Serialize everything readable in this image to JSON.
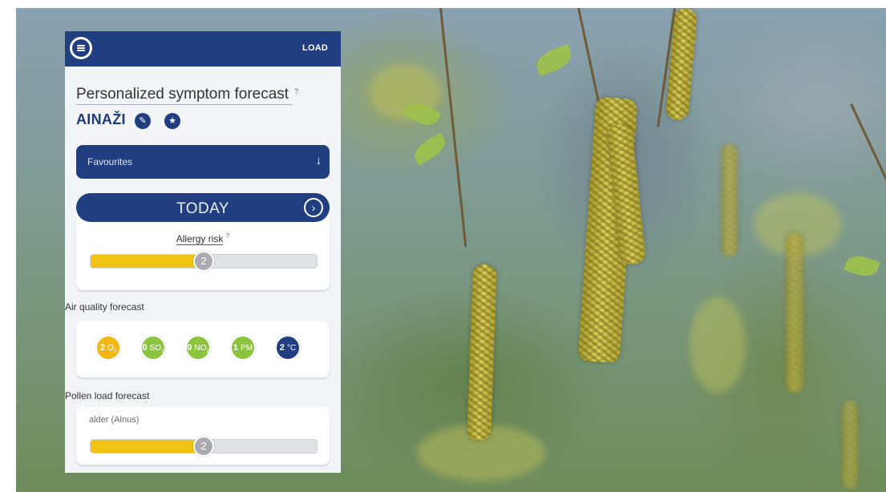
{
  "header": {
    "menu_icon": "hamburger-menu-icon",
    "load_label": "LOAD"
  },
  "forecast": {
    "title": "Personalized symptom forecast",
    "help_mark": "?",
    "location": "AINAŽI",
    "edit_icon": "pencil-icon",
    "favorite_icon": "star-icon"
  },
  "favourites_select": {
    "label": "Favourites",
    "arrow_icon": "arrow-down-icon"
  },
  "today": {
    "label": "TODAY",
    "next_icon": "chevron-right-circle-icon"
  },
  "allergy_risk": {
    "label": "Allergy risk",
    "help_mark": "?",
    "value": "2",
    "level_fraction": 0.5
  },
  "air_quality": {
    "title": "Air quality forecast",
    "items": [
      {
        "value": "2",
        "unit": "O",
        "sub": "3",
        "color": "#f0b715"
      },
      {
        "value": "0",
        "unit": "SO",
        "sub": "2",
        "color": "#8bc53f"
      },
      {
        "value": "0",
        "unit": "NO",
        "sub": "2",
        "color": "#8bc53f"
      },
      {
        "value": "1",
        "unit": "PM",
        "sub": "",
        "color": "#8bc53f"
      },
      {
        "value": "2",
        "unit": "°C",
        "sub": "",
        "color": "#203e80"
      }
    ]
  },
  "pollen": {
    "title": "Pollen load forecast",
    "items": [
      {
        "name": "alder (Alnus)",
        "value": "2",
        "level_fraction": 0.5
      }
    ]
  },
  "colors": {
    "primary": "#203e80",
    "risk_fill": "#f0c315",
    "track": "#e1e2e6",
    "knob": "#a9abb0"
  }
}
